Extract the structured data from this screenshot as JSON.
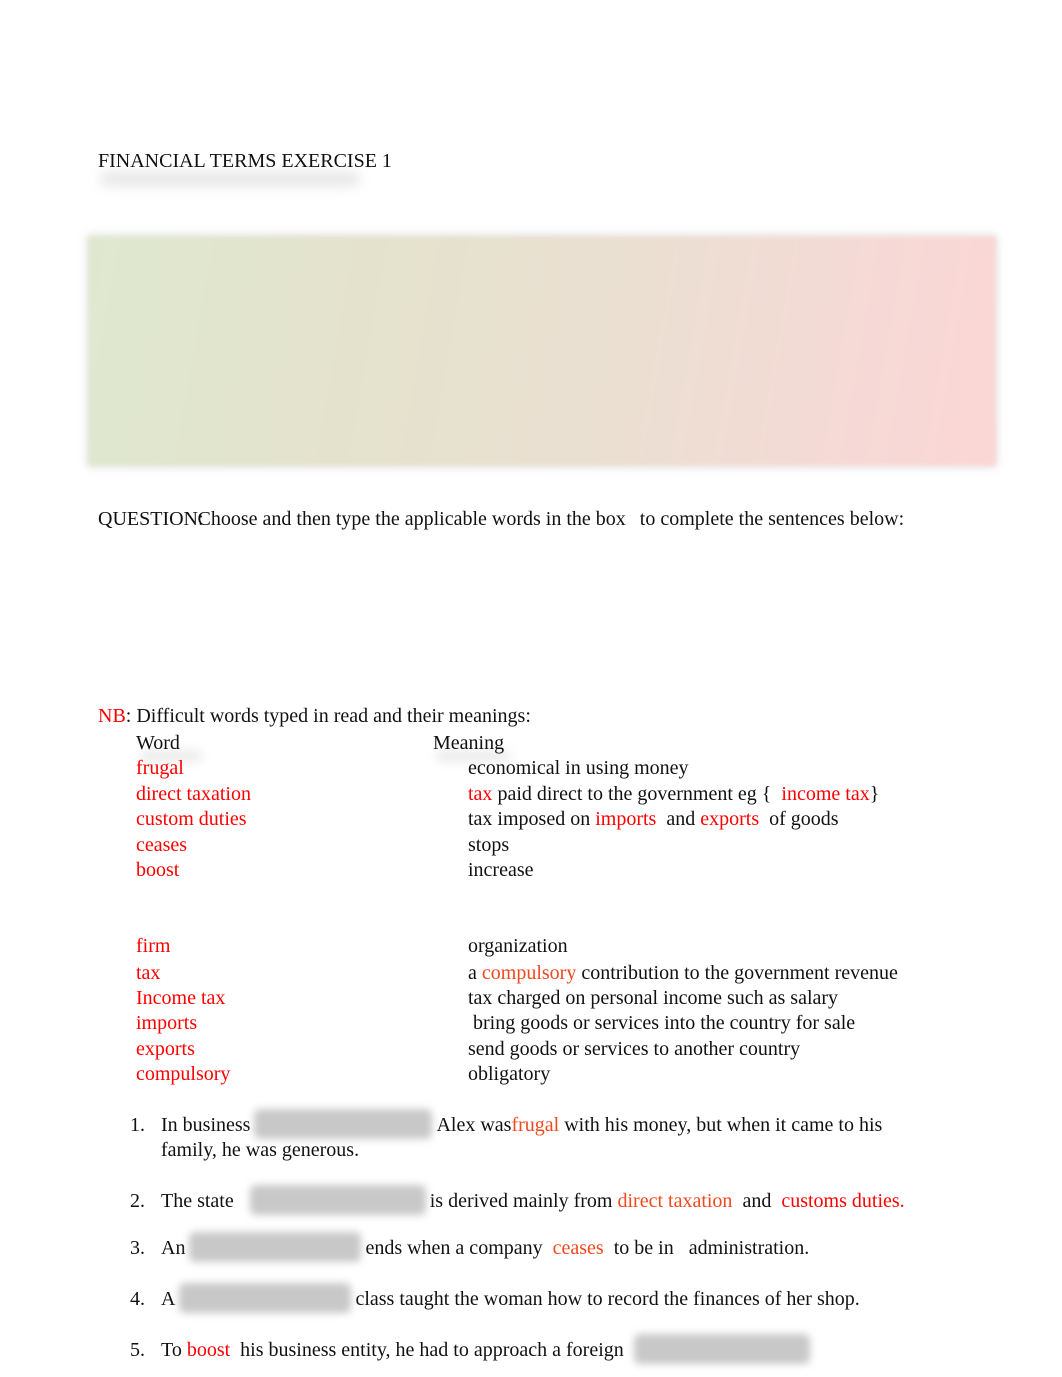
{
  "title": "FINANCIAL TERMS EXERCISE 1",
  "word_box": {
    "state": "blurred",
    "colors": {
      "left": "#dfe8cf",
      "right": "#fbd6d4"
    }
  },
  "question": {
    "label": "QUESTION:",
    "text_before_box": "Choose and then type the applicable words in the box",
    "text_after_box": "to complete the sentences below:"
  },
  "notes": {
    "nb_label": "NB",
    "intro": ": Difficult words typed in read and their meanings:",
    "header_word": "Word",
    "header_meaning": "Meaning",
    "group1": [
      {
        "word": "frugal",
        "meaning": [
          {
            "text": "economical in using money",
            "color": "black"
          }
        ]
      },
      {
        "word": "direct taxation",
        "meaning": [
          {
            "text": "tax",
            "color": "red"
          },
          {
            "text": " paid direct to the government eg {  ",
            "color": "black"
          },
          {
            "text": "income tax",
            "color": "red"
          },
          {
            "text": "}",
            "color": "black"
          }
        ]
      },
      {
        "word": "custom duties",
        "meaning": [
          {
            "text": "tax imposed on ",
            "color": "black"
          },
          {
            "text": "imports",
            "color": "red"
          },
          {
            "text": "  and ",
            "color": "black"
          },
          {
            "text": "exports",
            "color": "red"
          },
          {
            "text": "  of goods",
            "color": "black"
          }
        ]
      },
      {
        "word": "ceases",
        "meaning": [
          {
            "text": "stops",
            "color": "black"
          }
        ]
      },
      {
        "word": "boost",
        "meaning": [
          {
            "text": "increase",
            "color": "black"
          }
        ]
      }
    ],
    "group2": [
      {
        "word": "firm",
        "meaning": [
          {
            "text": "organization",
            "color": "black"
          }
        ]
      },
      {
        "word": "tax",
        "meaning": [
          {
            "text": "a ",
            "color": "black"
          },
          {
            "text": "compulsory",
            "color": "orange"
          },
          {
            "text": " contribution to the government revenue",
            "color": "black"
          }
        ]
      },
      {
        "word": "Income tax",
        "meaning": [
          {
            "text": "tax charged on personal income such as salary",
            "color": "black"
          }
        ]
      },
      {
        "word": "imports",
        "meaning": [
          {
            "text": " bring goods or services into the country for sale",
            "color": "black"
          }
        ]
      },
      {
        "word": "exports",
        "meaning": [
          {
            "text": "send goods or services to another country",
            "color": "black"
          }
        ]
      },
      {
        "word": "compulsory",
        "meaning": [
          {
            "text": "obligatory",
            "color": "black"
          }
        ]
      }
    ]
  },
  "sentences": [
    {
      "number": "1.",
      "parts": [
        {
          "text": "In business",
          "color": "black"
        },
        {
          "blank": true
        },
        {
          "text": "Alex was",
          "color": "black"
        },
        {
          "text": "frugal",
          "color": "orange"
        },
        {
          "text": " with his money, but when it came to his",
          "color": "black"
        }
      ],
      "continuation": "family, he was generous."
    },
    {
      "number": "2.",
      "parts": [
        {
          "text": "The state",
          "color": "black"
        },
        {
          "blank": true
        },
        {
          "text": "is derived mainly from ",
          "color": "black"
        },
        {
          "text": "direct taxation",
          "color": "orange"
        },
        {
          "text": "  and  ",
          "color": "black"
        },
        {
          "text": "customs duties.",
          "color": "red"
        }
      ]
    },
    {
      "number": "3.",
      "parts": [
        {
          "text": "An",
          "color": "black"
        },
        {
          "blank": true
        },
        {
          "text": "ends when a company  ",
          "color": "black"
        },
        {
          "text": "ceases",
          "color": "orange"
        },
        {
          "text": "  to be in   administration.",
          "color": "black"
        }
      ]
    },
    {
      "number": "4.",
      "parts": [
        {
          "text": "A",
          "color": "black"
        },
        {
          "blank": true
        },
        {
          "text": "class taught the woman how to record the finances of her shop.",
          "color": "black"
        }
      ]
    },
    {
      "number": "5.",
      "parts": [
        {
          "text": "To ",
          "color": "black"
        },
        {
          "text": "boost",
          "color": "red"
        },
        {
          "text": "  his business entity, he had to approach a foreign",
          "color": "black"
        },
        {
          "blank": true
        }
      ]
    }
  ]
}
